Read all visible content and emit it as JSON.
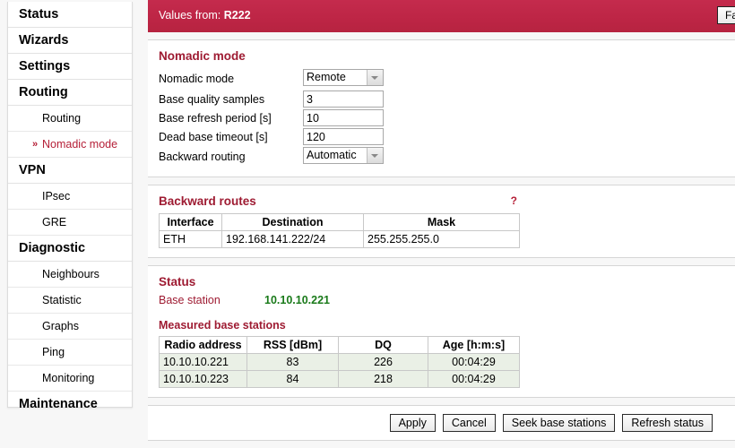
{
  "sidebar": {
    "items": [
      {
        "label": "Status",
        "type": "top",
        "active": false
      },
      {
        "label": "Wizards",
        "type": "top",
        "active": false
      },
      {
        "label": "Settings",
        "type": "top",
        "active": false
      },
      {
        "label": "Routing",
        "type": "top",
        "active": false
      },
      {
        "label": "Routing",
        "type": "sub",
        "active": false
      },
      {
        "label": "Nomadic mode",
        "type": "sub",
        "active": true,
        "marker": "»"
      },
      {
        "label": "VPN",
        "type": "top",
        "active": false
      },
      {
        "label": "IPsec",
        "type": "sub",
        "active": false
      },
      {
        "label": "GRE",
        "type": "sub",
        "active": false
      },
      {
        "label": "Diagnostic",
        "type": "top",
        "active": false
      },
      {
        "label": "Neighbours",
        "type": "sub",
        "active": false
      },
      {
        "label": "Statistic",
        "type": "sub",
        "active": false
      },
      {
        "label": "Graphs",
        "type": "sub",
        "active": false
      },
      {
        "label": "Ping",
        "type": "sub",
        "active": false
      },
      {
        "label": "Monitoring",
        "type": "sub",
        "active": false
      },
      {
        "label": "Maintenance",
        "type": "top",
        "active": false
      }
    ]
  },
  "topbar": {
    "prefix": "Values from: ",
    "device": "R222",
    "button_label": "Fa",
    "background": "#bd2545"
  },
  "nomadic": {
    "title": "Nomadic mode",
    "rows": [
      {
        "label": "Nomadic mode",
        "control": "select",
        "value": "Remote"
      },
      {
        "label": "Base quality samples",
        "control": "text",
        "value": "3"
      },
      {
        "label": "Base refresh period [s]",
        "control": "text",
        "value": "10"
      },
      {
        "label": "Dead base timeout [s]",
        "control": "text",
        "value": "120"
      },
      {
        "label": "Backward routing",
        "control": "select",
        "value": "Automatic"
      }
    ]
  },
  "backward_routes": {
    "title": "Backward routes",
    "help": "?",
    "columns": [
      "Interface",
      "Destination",
      "Mask"
    ],
    "rows": [
      {
        "interface": "ETH",
        "destination": "192.168.141.222/24",
        "mask": "255.255.255.0"
      }
    ]
  },
  "status": {
    "title": "Status",
    "base_station_label": "Base station",
    "base_station_value": "10.10.10.221",
    "base_station_color": "#1a7a1a",
    "measured_title": "Measured base stations",
    "columns": [
      "Radio address",
      "RSS [dBm]",
      "DQ",
      "Age [h:m:s]"
    ],
    "rows": [
      {
        "address": "10.10.10.221",
        "rss": "83",
        "dq": "226",
        "age": "00:04:29"
      },
      {
        "address": "10.10.10.223",
        "rss": "84",
        "dq": "218",
        "age": "00:04:29"
      }
    ]
  },
  "buttons": [
    {
      "label": "Apply"
    },
    {
      "label": "Cancel"
    },
    {
      "label": "Seek base stations"
    },
    {
      "label": "Refresh status"
    }
  ]
}
